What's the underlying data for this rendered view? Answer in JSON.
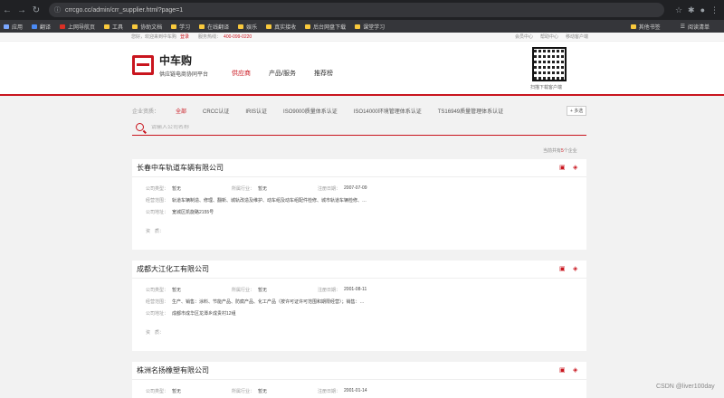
{
  "browser": {
    "url": "crrcgo.cc/admin/crr_supplier.html?page=1",
    "bookmarks": [
      "应用",
      "翻译",
      "上网导航页",
      "工具",
      "协助文档",
      "学习",
      "在线翻译",
      "娱乐",
      "真实接收",
      "后台网盘下载",
      "课堂学习"
    ],
    "bookmarks_right": [
      "其他书签",
      "阅读清单"
    ]
  },
  "topbar": {
    "welcome": "您好，欢迎来到中车购",
    "register": "登录",
    "hotline_label": "服务热线：",
    "hotline": "400-099-0220",
    "right_links": [
      "会员中心",
      "帮助中心",
      "移动客户端"
    ]
  },
  "header": {
    "logo_title": "中车购",
    "logo_subtitle": "供应链电商协同平台",
    "nav": [
      "供应商",
      "产品/服务",
      "推荐榜"
    ],
    "qr_label": "扫描下载客户端"
  },
  "filter": {
    "label": "企业资质：",
    "options": [
      "全部",
      "CRCC认证",
      "IRIS认证",
      "ISO9000质量体系认证",
      "ISO14000环境管理体系认证",
      "TS16949质量管理体系认证"
    ],
    "more": "+ 多选"
  },
  "search": {
    "placeholder": "请输入公司名称"
  },
  "count": {
    "prefix": "当前共有",
    "num": "5",
    "suffix": "个企业"
  },
  "companies": [
    {
      "name": "长春中车轨道车辆有限公司",
      "type_label": "公司类型：",
      "type": "暂无",
      "industry_label": "所属行业：",
      "industry": "暂无",
      "date_label": "注册日期：",
      "date": "2007-07-09",
      "scope_label": "经营范围：",
      "scope": "轨道车辆制造、修理、翻新、城轨改造及维护、动车组及动车组配件检修、城市轨道车辆检修、…",
      "addr_label": "公司地址：",
      "addr": "宽城区凯旋路2155号",
      "extra_label": "资　质："
    },
    {
      "name": "成都大江化工有限公司",
      "type_label": "公司类型：",
      "type": "暂无",
      "industry_label": "所属行业：",
      "industry": "暂无",
      "date_label": "注册日期：",
      "date": "2001-08-11",
      "scope_label": "经营范围：",
      "scope": "生产、销售：涂料、节能产品、防腐产品、化工产品（按许可证许可范围和期限经营）；销售：…",
      "addr_label": "公司地址：",
      "addr": "成都市成华区龙潭乡成贵村12组",
      "extra_label": "资　质："
    },
    {
      "name": "株洲名扬橡塑有限公司",
      "type_label": "公司类型：",
      "type": "暂无",
      "industry_label": "所属行业：",
      "industry": "暂无",
      "date_label": "注册日期：",
      "date": "2001-01-14"
    }
  ],
  "watermark": "CSDN @liver100day"
}
